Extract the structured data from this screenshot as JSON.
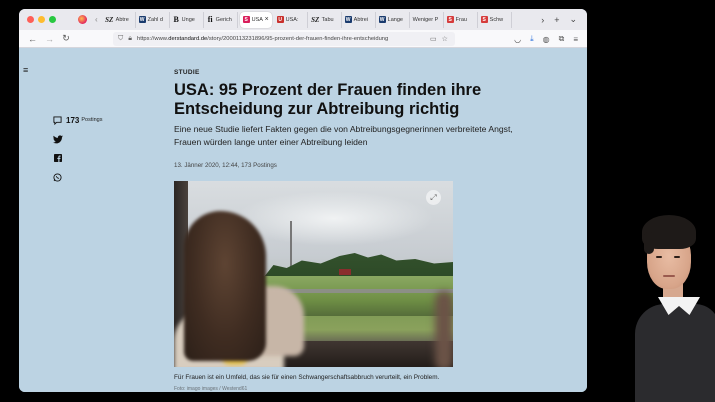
{
  "browser": {
    "tabs": [
      {
        "favicon": "sz",
        "label": "Abtre",
        "active": false
      },
      {
        "favicon": "w",
        "label": "Zahl d",
        "active": false
      },
      {
        "favicon": "b",
        "label": "Unge",
        "active": false
      },
      {
        "favicon": "fi",
        "label": "Gerich",
        "active": false
      },
      {
        "favicon": "ds",
        "label": "USA",
        "active": true
      },
      {
        "favicon": "red",
        "label": "USA:",
        "active": false
      },
      {
        "favicon": "sz",
        "label": "Tabu",
        "active": false
      },
      {
        "favicon": "w",
        "label": "Abtrei",
        "active": false
      },
      {
        "favicon": "w",
        "label": "Lange",
        "active": false
      },
      {
        "favicon": "none",
        "label": "Weniger P",
        "active": false
      },
      {
        "favicon": "ds2",
        "label": "Frau",
        "active": false
      },
      {
        "favicon": "ds2",
        "label": "Schw",
        "active": false
      }
    ],
    "url_prefix": "https://www.",
    "url_host": "derstandard.de",
    "url_path": "/story/2000113231896/95-prozent-der-frauen-finden-ihre-entscheidung"
  },
  "article": {
    "kicker": "STUDIE",
    "headline": "USA: 95 Prozent der Frauen finden ihre Entscheidung zur Abtreibung richtig",
    "lead": "Eine neue Studie liefert Fakten gegen die von Abtreibungsgegnerinnen verbreitete Angst, Frauen würden lange unter einer Abtreibung leiden",
    "meta": "13. Jänner 2020, 12:44, 173 Postings",
    "caption": "Für Frauen ist ein Umfeld, das sie für einen Schwangerschaftsabbruch verurteilt, ein Problem.",
    "credit": "Foto: imago images / Westend61"
  },
  "share": {
    "posting_count": "173",
    "posting_label": "Postings",
    "icons": [
      "comment-icon",
      "twitter-icon",
      "facebook-icon",
      "whatsapp-icon"
    ]
  },
  "colors": {
    "page_background": "#bcd3e3",
    "accent": "#d91e5b"
  }
}
